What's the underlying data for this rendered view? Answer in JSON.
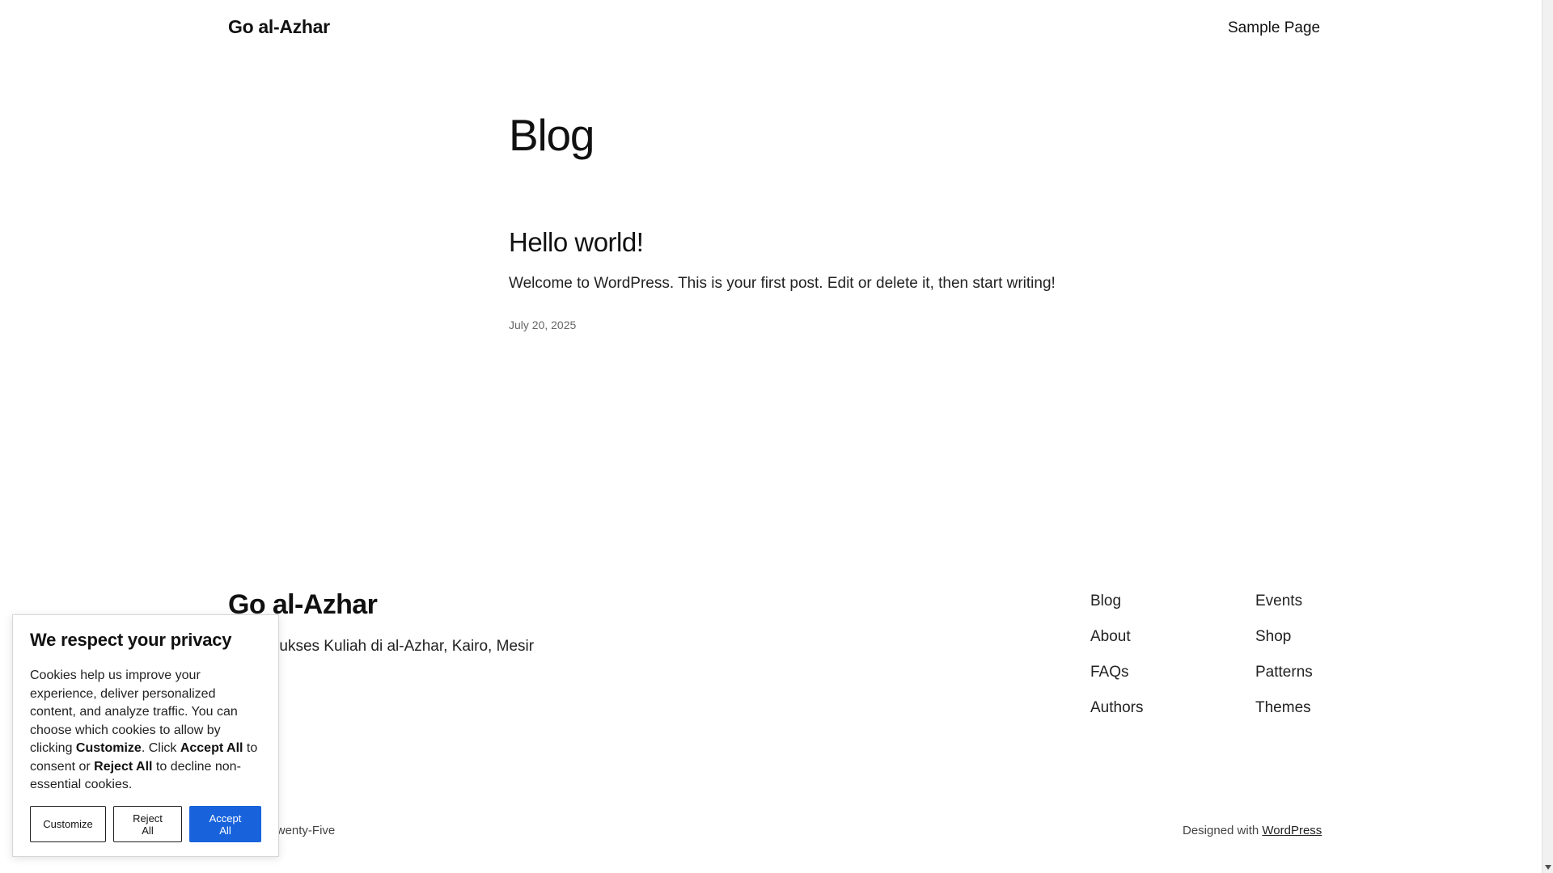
{
  "header": {
    "site_title": "Go al-Azhar",
    "nav": {
      "sample_page": "Sample Page"
    }
  },
  "main": {
    "page_title": "Blog",
    "posts": [
      {
        "title": "Hello world!",
        "excerpt": "Welcome to WordPress. This is your first post. Edit or delete it, then start writing!",
        "date": "July 20, 2025"
      }
    ]
  },
  "footer": {
    "site_title": "Go al-Azhar",
    "tagline": "Jalan Sukses Kuliah di al-Azhar, Kairo, Mesir",
    "links_col1": [
      "Blog",
      "About",
      "FAQs",
      "Authors"
    ],
    "links_col2": [
      "Events",
      "Shop",
      "Patterns",
      "Themes"
    ],
    "theme_credit": "Twenty Twenty-Five",
    "designed_with": "Designed with",
    "wordpress_link": "WordPress"
  },
  "cookie_banner": {
    "title": "We respect your privacy",
    "text_1": "Cookies help us improve your experience, deliver personalized content, and analyze traffic. You can choose which cookies to allow by clicking ",
    "bold_customize": "Customize",
    "text_2": ". Click ",
    "bold_accept": "Accept All",
    "text_3": " to consent or ",
    "bold_reject": "Reject All",
    "text_4": " to decline non-essential cookies.",
    "buttons": {
      "customize": "Customize",
      "reject": "Reject All",
      "accept": "Accept All"
    },
    "accent_color": "#1863dc"
  }
}
